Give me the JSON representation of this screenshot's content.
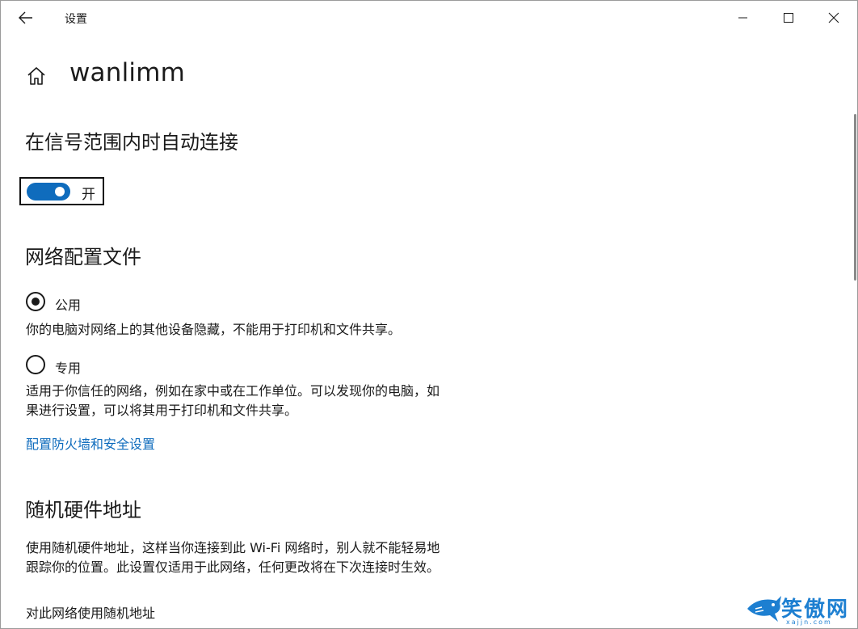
{
  "window": {
    "title": "设置",
    "controls": {
      "minimize": "minimize-icon",
      "maximize": "maximize-icon",
      "close": "close-icon"
    }
  },
  "header": {
    "network_name": "wanlimm",
    "home_icon": "home-icon",
    "back_icon": "back-arrow-icon"
  },
  "auto_connect": {
    "heading": "在信号范围内时自动连接",
    "toggle_state_label": "开",
    "toggle_on": true,
    "accent_color": "#0f6cbd"
  },
  "network_profile": {
    "heading": "网络配置文件",
    "options": [
      {
        "label": "公用",
        "selected": true,
        "description": "你的电脑对网络上的其他设备隐藏，不能用于打印机和文件共享。"
      },
      {
        "label": "专用",
        "selected": false,
        "description_line1": "适用于你信任的网络，例如在家中或在工作单位。可以发现你的电脑，如",
        "description_line2": "果进行设置，可以将其用于打印机和文件共享。"
      }
    ],
    "firewall_link": "配置防火墙和安全设置"
  },
  "random_hardware": {
    "heading": "随机硬件地址",
    "description_line1": "使用随机硬件地址，这样当你连接到此 Wi-Fi 网络时，别人就不能轻易地",
    "description_line2": "跟踪你的位置。此设置仅适用于此网络，任何更改将在下次连接时生效。",
    "sub_label": "对此网络使用随机地址"
  },
  "watermark": {
    "text": "笑傲网",
    "subtext": "xajjn.com"
  }
}
